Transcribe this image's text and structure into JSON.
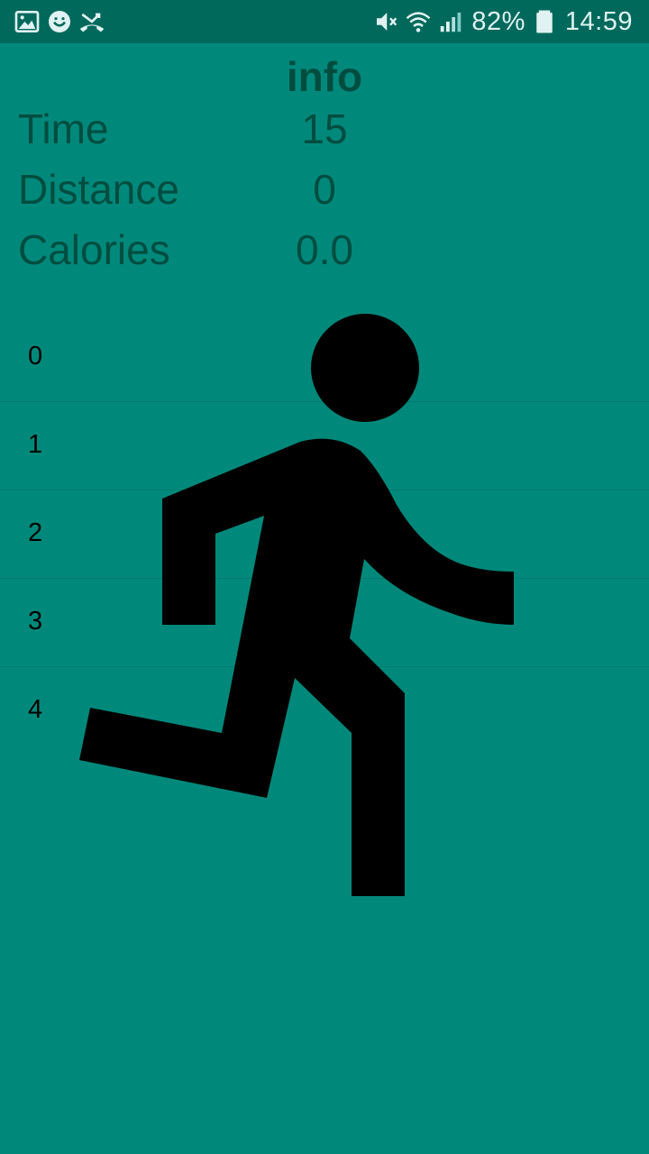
{
  "status_bar": {
    "battery": "82%",
    "time": "14:59",
    "icons": [
      "gallery-icon",
      "smiley-icon",
      "missed-call-icon",
      "mute-icon",
      "wifi-icon",
      "signal-icon",
      "battery-icon"
    ]
  },
  "info": {
    "title": "info",
    "stats": [
      {
        "label": "Time",
        "value": "15"
      },
      {
        "label": "Distance",
        "value": "0"
      },
      {
        "label": "Calories",
        "value": "0.0"
      }
    ]
  },
  "list": {
    "items": [
      "0",
      "1",
      "2",
      "3",
      "4"
    ]
  },
  "colors": {
    "background": "#00897B",
    "status_bar": "#00695C",
    "text_dark": "#004D40",
    "runner": "#000000"
  },
  "figure": {
    "icon": "running-person-icon"
  }
}
